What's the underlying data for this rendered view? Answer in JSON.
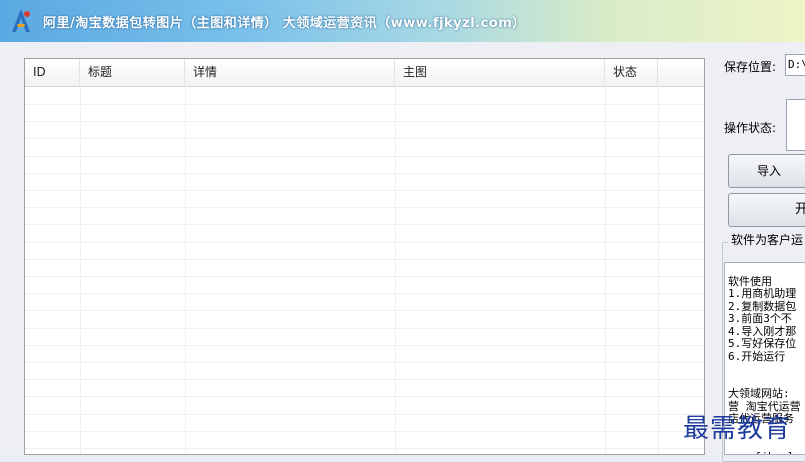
{
  "window": {
    "title": "阿里/淘宝数据包转图片（主图和详情）    大领域运营资讯（www.fjkyzl.com）"
  },
  "table": {
    "columns": [
      "ID",
      "标题",
      "详情",
      "主图",
      "状态"
    ]
  },
  "right_panel": {
    "save_location_label": "保存位置:",
    "save_location_value": "D:\\",
    "operation_status_label": "操作状态:",
    "import_button": "导入",
    "start_button": "开",
    "group_title": "软件为客户运",
    "notes": [
      "",
      "软件使用",
      "1.用商机助理",
      "2.复制数据包",
      "3.前面3个不",
      "4.导入刚才那",
      "5.写好保存位",
      "6.开始运行",
      "",
      "",
      "大领域网站:",
      "营 淘宝代运营",
      "店代运营服务",
      "",
      "",
      "www.fjkyzl.com"
    ]
  },
  "watermark": "最需教育",
  "colors": {
    "title_text": "#ffffff",
    "watermark": "#1d3b9b"
  }
}
